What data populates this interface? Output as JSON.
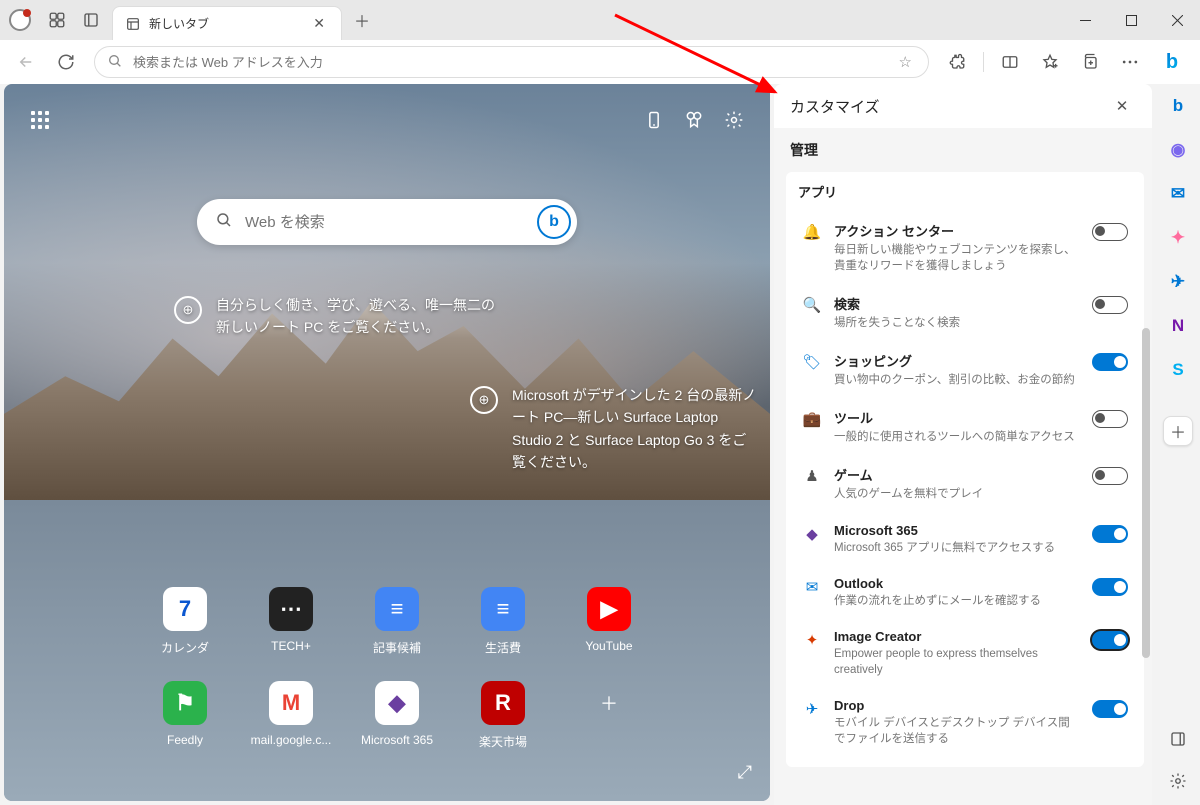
{
  "tab": {
    "title": "新しいタブ"
  },
  "address_bar": {
    "placeholder": "検索または Web アドレスを入力"
  },
  "ntp": {
    "search_placeholder": "Web を検索",
    "promo1": "自分らしく働き、学び、遊べる、唯一無二の新しいノート PC をご覧ください。",
    "promo2": "Microsoft がデザインした 2 台の最新ノート PC—新しい Surface Laptop Studio 2 と Surface Laptop Go 3 をご覧ください。",
    "tiles": [
      {
        "label": "カレンダ",
        "letter": "7",
        "bg": "#ffffff",
        "fg": "#0b57d0"
      },
      {
        "label": "TECH+",
        "letter": "⋯",
        "bg": "#222222",
        "fg": "#ffffff"
      },
      {
        "label": "記事候補",
        "letter": "≡",
        "bg": "#4285f4",
        "fg": "#ffffff"
      },
      {
        "label": "生活費",
        "letter": "≡",
        "bg": "#4285f4",
        "fg": "#ffffff"
      },
      {
        "label": "YouTube",
        "letter": "▶",
        "bg": "#ff0000",
        "fg": "#ffffff"
      },
      {
        "label": "Feedly",
        "letter": "⚑",
        "bg": "#2bb24c",
        "fg": "#ffffff"
      },
      {
        "label": "mail.google.c...",
        "letter": "M",
        "bg": "#ffffff",
        "fg": "#ea4335"
      },
      {
        "label": "Microsoft 365",
        "letter": "◆",
        "bg": "#ffffff",
        "fg": "#6b3fa0"
      },
      {
        "label": "楽天市場",
        "letter": "R",
        "bg": "#bf0000",
        "fg": "#ffffff"
      }
    ]
  },
  "customize": {
    "title": "カスタマイズ",
    "section": "管理",
    "card_title": "アプリ",
    "items": [
      {
        "icon": "🔔",
        "icon_color": "#0078d4",
        "title": "アクション センター",
        "desc": "毎日新しい機能やウェブコンテンツを探索し、貴重なリワードを獲得しましょう",
        "on": false
      },
      {
        "icon": "🔍",
        "icon_color": "#555555",
        "title": "検索",
        "desc": "場所を失うことなく検索",
        "on": false
      },
      {
        "icon": "🏷",
        "icon_color": "#0078d4",
        "title": "ショッピング",
        "desc": "買い物中のクーポン、割引の比較、お金の節約",
        "on": true
      },
      {
        "icon": "💼",
        "icon_color": "#a0522d",
        "title": "ツール",
        "desc": "一般的に使用されるツールへの簡単なアクセス",
        "on": false
      },
      {
        "icon": "♟",
        "icon_color": "#555555",
        "title": "ゲーム",
        "desc": "人気のゲームを無料でプレイ",
        "on": false
      },
      {
        "icon": "◆",
        "icon_color": "#6b3fa0",
        "title": "Microsoft 365",
        "desc": "Microsoft 365 アプリに無料でアクセスする",
        "on": true
      },
      {
        "icon": "✉",
        "icon_color": "#0078d4",
        "title": "Outlook",
        "desc": "作業の流れを止めずにメールを確認する",
        "on": true
      },
      {
        "icon": "✦",
        "icon_color": "#d83b01",
        "title": "Image Creator",
        "desc": "Empower people to express themselves creatively",
        "on": true,
        "outlined": true
      },
      {
        "icon": "✈",
        "icon_color": "#0078d4",
        "title": "Drop",
        "desc": "モバイル デバイスとデスクトップ デバイス間でファイルを送信する",
        "on": true
      }
    ]
  },
  "sidebar_icons": [
    {
      "name": "bing",
      "glyph": "b",
      "color": "#0078d4"
    },
    {
      "name": "copilot",
      "glyph": "◉",
      "color": "#7b68ee"
    },
    {
      "name": "outlook",
      "glyph": "✉",
      "color": "#0078d4"
    },
    {
      "name": "image-creator",
      "glyph": "✦",
      "color": "#ff6b9d"
    },
    {
      "name": "drop",
      "glyph": "✈",
      "color": "#0078d4"
    },
    {
      "name": "onenote",
      "glyph": "N",
      "color": "#7719aa"
    },
    {
      "name": "skype",
      "glyph": "S",
      "color": "#00aff0"
    }
  ]
}
